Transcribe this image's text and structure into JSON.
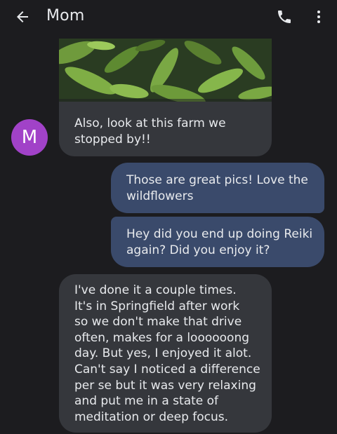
{
  "header": {
    "title": "Mom",
    "back_icon": "arrow-back-icon",
    "call_icon": "phone-icon",
    "menu_icon": "more-vert-icon"
  },
  "contact": {
    "avatar_initial": "M",
    "avatar_color": "#a142c8"
  },
  "photo": {
    "description_icon": "photo-image"
  },
  "messages": [
    {
      "direction": "incoming",
      "lines": [
        "Also, look at this farm we",
        "stopped by!!"
      ]
    },
    {
      "direction": "outgoing",
      "lines": [
        "Those are great pics! Love the",
        "wildflowers"
      ]
    },
    {
      "direction": "outgoing",
      "lines": [
        "Hey did you end up doing Reiki",
        "again? Did you enjoy it?"
      ]
    },
    {
      "direction": "incoming",
      "lines": [
        "I've done it a couple times.",
        "It's in Springfield after work",
        "so we don't make that drive",
        "often, makes for a loooooong",
        "day. But yes, I enjoyed it alot.",
        "Can't say I noticed a difference",
        "per se but it was very relaxing",
        "and put me in a state of",
        "meditation or deep focus."
      ]
    }
  ],
  "colors": {
    "background": "#1c1c1f",
    "incoming_bubble": "#35373c",
    "outgoing_bubble": "#3a4a6b",
    "text": "#e8eaed"
  }
}
